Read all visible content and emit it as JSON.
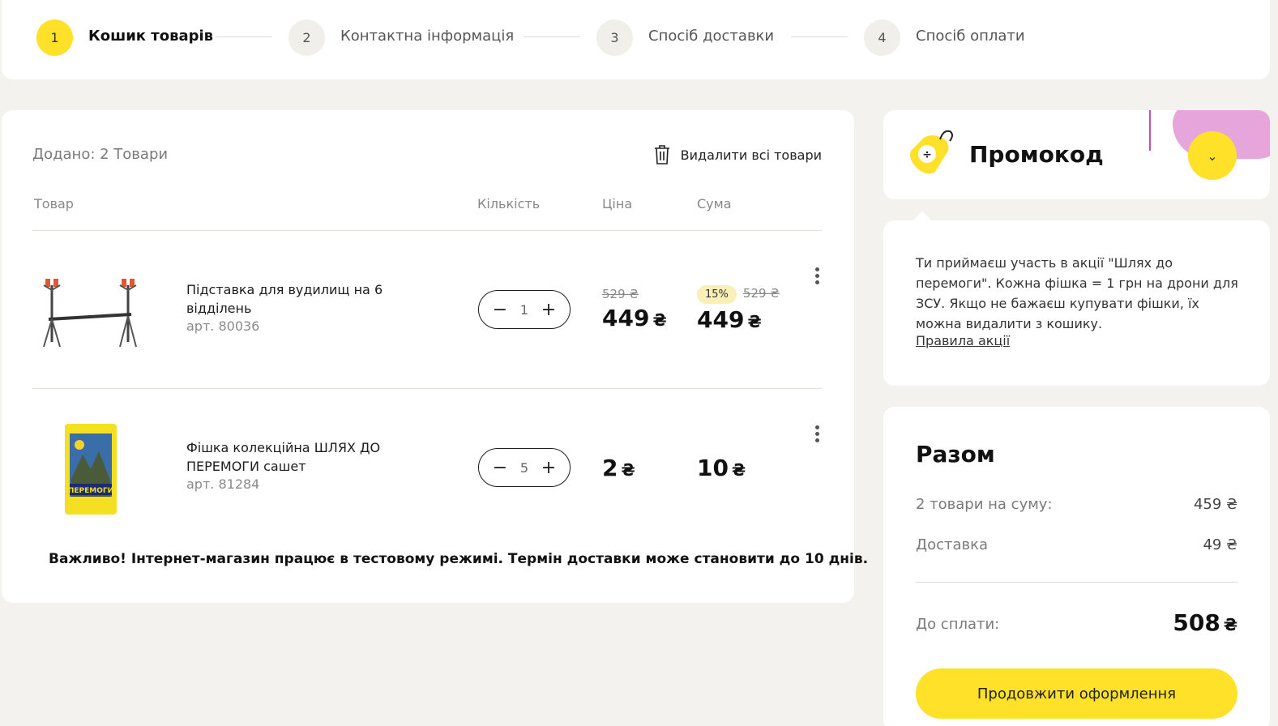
{
  "steps": [
    {
      "num": "1",
      "label": "Кошик товарів"
    },
    {
      "num": "2",
      "label": "Контактна інформація"
    },
    {
      "num": "3",
      "label": "Спосіб доставки"
    },
    {
      "num": "4",
      "label": "Спосіб оплати"
    }
  ],
  "cart": {
    "added": "Додано: 2 Товари",
    "delete_all": "Видалити всі товари",
    "headers": {
      "product": "Товар",
      "qty": "Кількість",
      "price": "Ціна",
      "sum": "Сума"
    },
    "items": [
      {
        "name": "Підставка для вудилищ на 6 відділень",
        "art": "арт. 80036",
        "qty": "1",
        "old_price": "529 ₴",
        "price": "449",
        "discount": "15%",
        "old_sum": "529 ₴",
        "sum": "449",
        "currency": "₴"
      },
      {
        "name": "Фішка колекційна ШЛЯХ ДО ПЕРЕМОГИ сашет",
        "art": "арт. 81284",
        "qty": "5",
        "price": "2",
        "sum": "10",
        "currency": "₴"
      }
    ],
    "notice": "Важливо! Інтернет-магазин працює в тестовому режимі. Термін доставки може становити до 10 днів."
  },
  "promo": {
    "title": "Промокод"
  },
  "info": {
    "text": "Ти приймаєш участь в акції \"Шлях до перемоги\". Кожна фішка = 1 грн на дрони для ЗСУ. Якщо не бажаєш купувати фішки, їх можна видалити з кошику.",
    "link": "Правила акції"
  },
  "total": {
    "title": "Разом",
    "items_label": "2 товари на суму:",
    "items_value": "459 ₴",
    "delivery_label": "Доставка",
    "delivery_value": "49 ₴",
    "grand_label": "До сплати:",
    "grand_value": "508",
    "currency": "₴",
    "checkout": "Продовжити оформлення"
  },
  "colors": {
    "accent": "#ffe12a",
    "background": "#f3f2ee",
    "promo_blob": "#e6a6dc"
  }
}
